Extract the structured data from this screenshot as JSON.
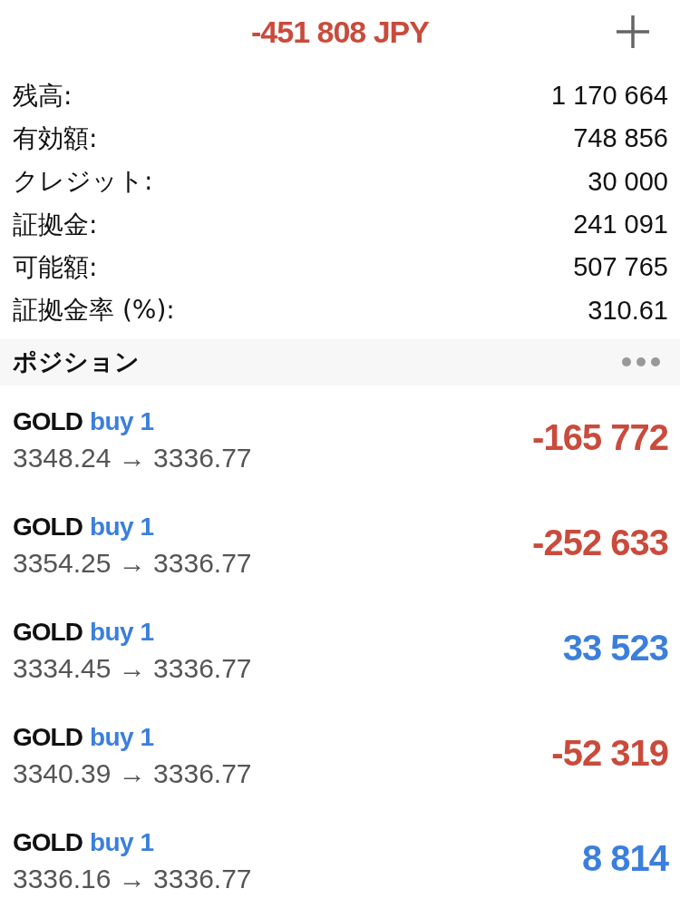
{
  "header": {
    "total": "-451 808 JPY"
  },
  "account": [
    {
      "label": "残高:",
      "value": "1 170 664"
    },
    {
      "label": "有効額:",
      "value": "748 856"
    },
    {
      "label": "クレジット:",
      "value": "30 000"
    },
    {
      "label": "証拠金:",
      "value": "241 091"
    },
    {
      "label": "可能額:",
      "value": "507 765"
    },
    {
      "label": "証拠金率 (%):",
      "value": "310.61"
    }
  ],
  "section": {
    "title": "ポジション"
  },
  "positions": [
    {
      "symbol": "GOLD",
      "order": "buy 1",
      "prices": "3348.24 → 3336.77",
      "profit": "-165 772",
      "color": "#c94b3c"
    },
    {
      "symbol": "GOLD",
      "order": "buy 1",
      "prices": "3354.25 → 3336.77",
      "profit": "-252 633",
      "color": "#c94b3c"
    },
    {
      "symbol": "GOLD",
      "order": "buy 1",
      "prices": "3334.45 → 3336.77",
      "profit": "33 523",
      "color": "#3b7fdd"
    },
    {
      "symbol": "GOLD",
      "order": "buy 1",
      "prices": "3340.39 → 3336.77",
      "profit": "-52 319",
      "color": "#c94b3c"
    },
    {
      "symbol": "GOLD",
      "order": "buy 1",
      "prices": "3336.16 → 3336.77",
      "profit": "8 814",
      "color": "#3b7fdd"
    }
  ]
}
